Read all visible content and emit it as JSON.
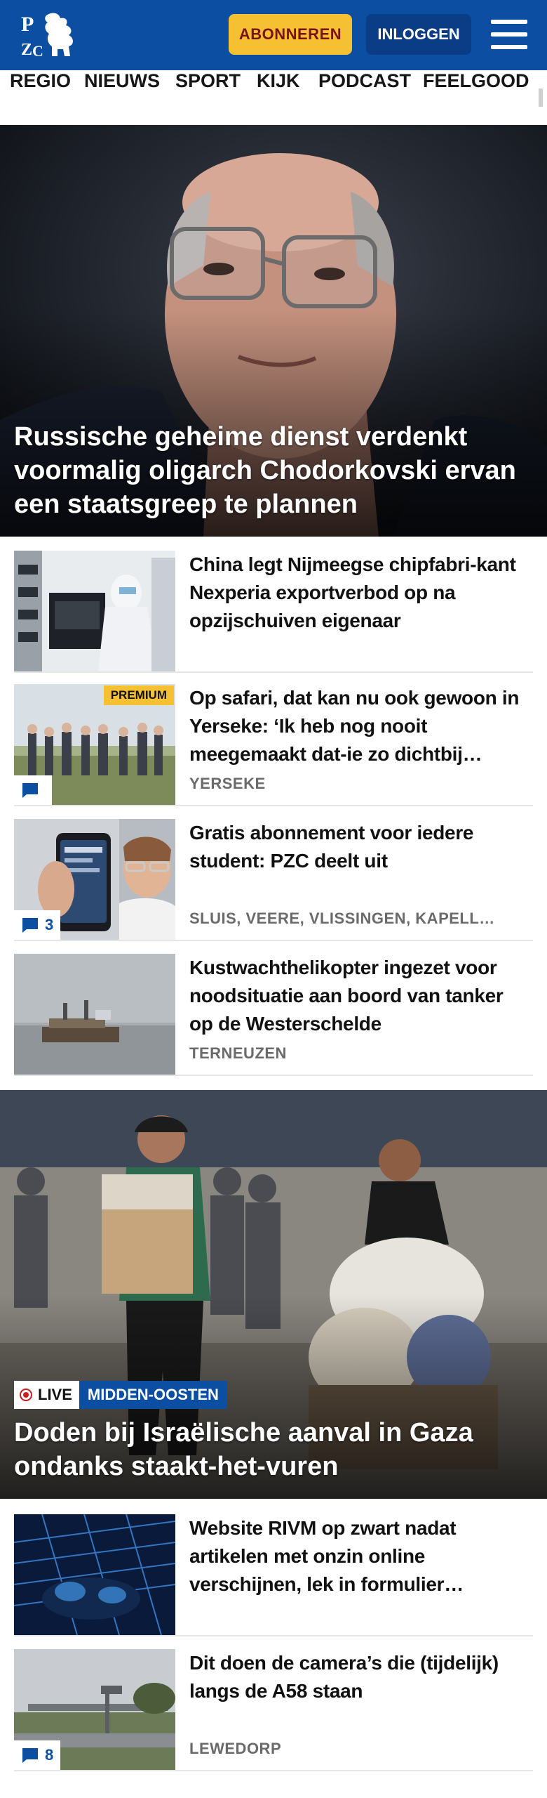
{
  "header": {
    "logo_text": "PZC",
    "subscribe_label": "ABONNEREN",
    "login_label": "INLOGGEN",
    "brand_color": "#0b4ea2",
    "accent_color": "#f5c132"
  },
  "nav": {
    "items": [
      "REGIO",
      "NIEUWS",
      "SPORT",
      "KIJK",
      "PODCAST",
      "FEELGOOD"
    ]
  },
  "hero": {
    "title": "Russische geheime dienst verdenkt voormalig oligarch Chodorkovski ervan een staatsgreep te plannen"
  },
  "articles": [
    {
      "title": "China legt Nijmeegse chipfabri-kant Nexperia exportverbod op na opzijschuiven eigenaar",
      "location": ""
    },
    {
      "title": "Op safari, dat kan nu ook gewoon in Yerseke: ‘Ik heb nog nooit meegemaakt dat-ie zo dichtbij…",
      "location": "YERSEKE",
      "badge": "PREMIUM",
      "comments": ""
    },
    {
      "title": "Gratis abonnement voor iedere student: PZC deelt uit",
      "location": "SLUIS, VEERE, VLISSINGEN, KAPELL…",
      "comments": "3"
    },
    {
      "title": "Kustwachthelikopter ingezet voor noodsituatie aan boord van tanker op de Westerschelde",
      "location": "TERNEUZEN"
    }
  ],
  "hero2": {
    "live_label": "LIVE",
    "category": "MIDDEN-OOSTEN",
    "title": "Doden bij Israëlische aanval in Gaza ondanks staakt-het-vuren"
  },
  "articles2": [
    {
      "title": "Website RIVM op zwart nadat artikelen met onzin online verschijnen, lek in formulier…",
      "location": ""
    },
    {
      "title": "Dit doen de camera’s die (tijdelijk) langs de A58 staan",
      "location": "LEWEDORP",
      "comments": "8"
    }
  ]
}
